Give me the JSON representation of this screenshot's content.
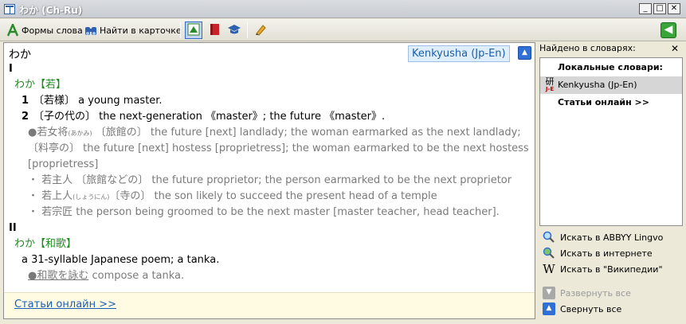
{
  "window": {
    "title": "わか (Ch-Ru)",
    "buttons": [
      "_",
      "□",
      "✕"
    ]
  },
  "toolbar": {
    "word_forms": "Формы слова",
    "find_in_card": "Найти в карточке"
  },
  "main": {
    "headword": "わか",
    "dictionary_badge": "Kenkyusha (Jp-En)",
    "entries": [
      {
        "roman": "I",
        "head": "わか【若】",
        "senses": [
          {
            "num": "1",
            "text": "〔若様〕 a young master."
          },
          {
            "num": "2",
            "text": "〔子の代の〕 the next-generation 《master》; the future 《master》."
          }
        ],
        "examples": [
          {
            "prefix": "●若女将",
            "ruby": "(あかみ)",
            "text": "〔旅館の〕 the future [next] landlady; the woman earmarked as the next landlady;"
          },
          {
            "prefix": "",
            "ruby": "",
            "text": "〔料亭の〕 the future [next] hostess [proprietress]; the woman earmarked to be the next hostess"
          },
          {
            "prefix": "",
            "ruby": "",
            "text": "[proprietress]"
          },
          {
            "prefix": "・ 若主人",
            "ruby": "",
            "text": "〔旅館などの〕 the future proprietor; the person earmarked to be the next proprietor"
          },
          {
            "prefix": "・ 若上人",
            "ruby": "(しょうにん)",
            "text": "〔寺の〕 the son likely to succeed the present head of a temple"
          },
          {
            "prefix": "・ 若宗匠",
            "ruby": "",
            "text": "the person being groomed to be the next master [master teacher, head teacher]."
          }
        ]
      },
      {
        "roman": "II",
        "head": "わか【和歌】",
        "senses": [
          {
            "num": "",
            "text": "a 31-syllable Japanese poem; a tanka."
          }
        ],
        "examples": [
          {
            "prefix": "●和歌を詠む",
            "ruby": "",
            "text": "compose a tanka."
          }
        ]
      }
    ],
    "online_articles": "Статьи онлайн >>"
  },
  "sidebar": {
    "header": "Найдено в словарях:",
    "close": "✕",
    "local_dicts": "Локальные словари:",
    "dict_item": "Kenkyusha (Jp-En)",
    "dict_icon_main": "研",
    "dict_icon_sub": "J-E",
    "online_articles": "Статьи онлайн >>",
    "actions": {
      "search_lingvo": "Искать в ABBYY Lingvo",
      "search_internet": "Искать в интернете",
      "search_wikipedia": "Искать в \"Википедии\"",
      "expand_all": "Развернуть все",
      "collapse_all": "Свернуть все"
    }
  },
  "colors": {
    "kana_green": "#1f8a1f",
    "link_blue": "#1a5fb4",
    "example_gray": "#7a7a7a",
    "online_bar": "#fffbe3"
  }
}
